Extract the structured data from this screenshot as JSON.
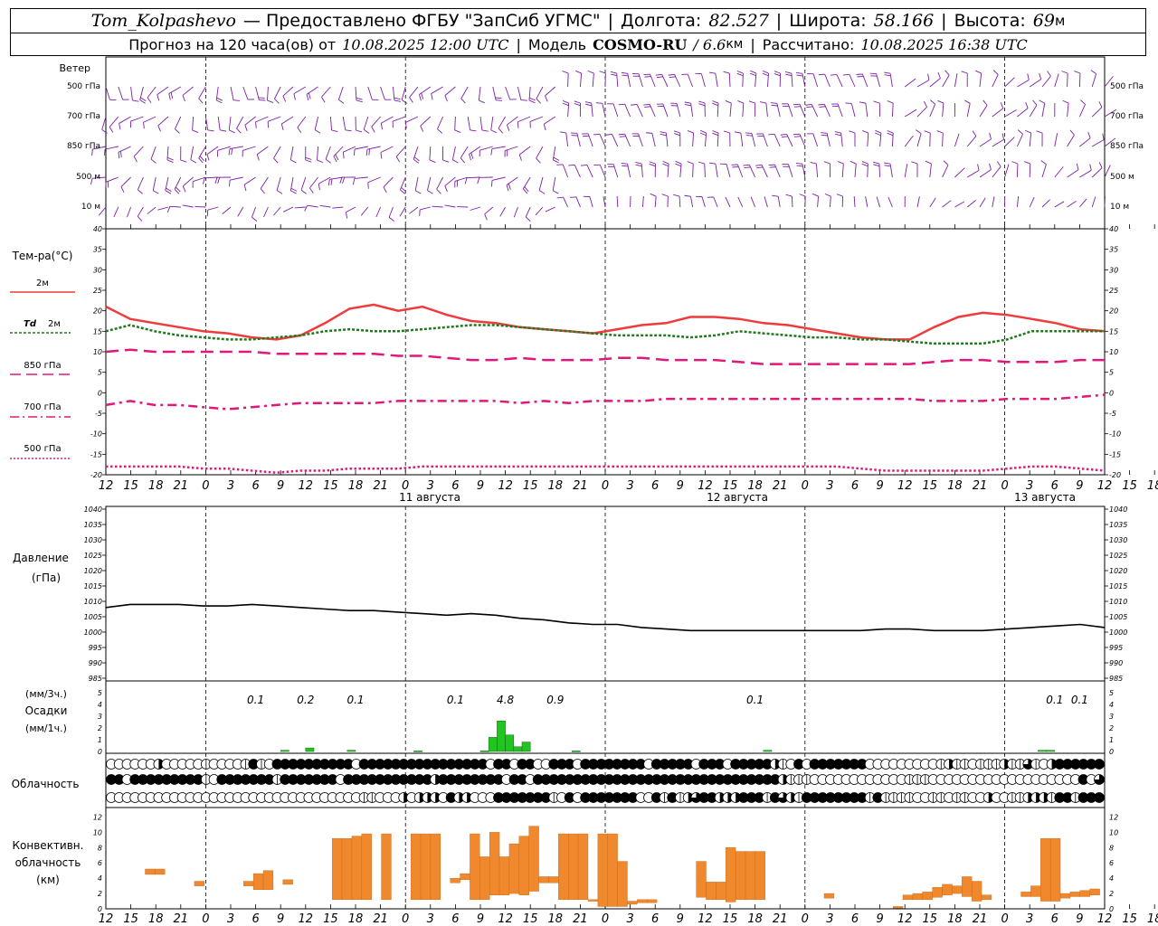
{
  "header": {
    "station": "Tom_Kolpashevo",
    "provider": "— Предоставлено ФГБУ \"ЗапСиб УГМС\"",
    "lon_label": "Долгота:",
    "lon_value": "82.527",
    "lat_label": "Широта:",
    "lat_value": "58.166",
    "alt_label": "Высота:",
    "alt_value": "69",
    "alt_unit": "м",
    "forecast_prefix": "Прогноз на 120 часа(ов) от",
    "forecast_start": "10.08.2025 12:00 UTC",
    "model_label": "Модель",
    "model_name": "COSMO-RU",
    "model_res": "/ 6.6",
    "model_res_unit": "км",
    "calc_label": "Рассчитано:",
    "calc_time": "10.08.2025 16:38 UTC"
  },
  "colors": {
    "wind": "#7b1fa2",
    "t2m": "#ef3b3b",
    "td2m": "#1f7a1f",
    "t850": "#e0187a",
    "t700": "#e0187a",
    "t500": "#e0187a",
    "pressure": "#000000",
    "precip": "#22c422",
    "convective": "#f0892e"
  },
  "labels": {
    "wind": "Ветер",
    "wind_levels": [
      "500 гПа",
      "700 гПа",
      "850 гПа",
      "500 м",
      "10 м"
    ],
    "temp_title": "Тем-ра(°С)",
    "legend_t2m": "2м",
    "legend_td_sym": "Td",
    "legend_td": "2м",
    "legend_850": "850 гПа",
    "legend_700": "700 гПа",
    "legend_500": "500 гПа",
    "pressure_title": "Давление",
    "pressure_unit": "(гПа)",
    "precip_top": "(мм/3ч.)",
    "precip_title": "Осадки",
    "precip_unit": "(мм/1ч.)",
    "cloud_title": "Облачность",
    "conv_title1": "Конвективн.",
    "conv_title2": "облачность",
    "conv_unit": "(км)",
    "dates": [
      "11 августа",
      "12 августа",
      "13 августа"
    ]
  },
  "chart_data": [
    {
      "type": "line",
      "title": "Тем-ра(°С)",
      "x_hours": [
        0,
        3,
        6,
        9,
        12,
        15,
        18,
        21,
        24,
        27,
        30,
        33,
        36,
        39,
        42,
        45,
        48,
        51,
        54,
        57,
        60,
        63,
        66,
        69,
        72,
        75,
        78,
        81,
        84,
        87,
        90,
        93,
        96,
        99,
        102,
        105,
        108,
        111,
        114,
        117,
        120
      ],
      "x_tick_labels": [
        "12",
        "15",
        "18",
        "21",
        "0",
        "3",
        "6",
        "9",
        "12",
        "15",
        "18",
        "21",
        "0",
        "3",
        "6",
        "9",
        "12",
        "15",
        "18",
        "21",
        "0",
        "3",
        "6",
        "9",
        "12",
        "15",
        "18",
        "21",
        "0",
        "3",
        "6",
        "9",
        "12",
        "15",
        "18",
        "21",
        "0",
        "3",
        "6",
        "9",
        "12",
        "15",
        "18"
      ],
      "ylim": [
        -20,
        40
      ],
      "yticks": [
        40,
        35,
        30,
        25,
        20,
        15,
        10,
        5,
        0,
        -5,
        -10,
        -15,
        -20
      ],
      "series": [
        {
          "name": "2м",
          "key": "t2m",
          "values": [
            21,
            18,
            17,
            16,
            15,
            14.5,
            13.5,
            13,
            14,
            17,
            20.5,
            21.5,
            20,
            21,
            19,
            17.5,
            17,
            16,
            15.5,
            15,
            14.5,
            15.5,
            16.5,
            17,
            18.5,
            18.5,
            18,
            17,
            16.5,
            15.5,
            14.5,
            13.5,
            13,
            13,
            16,
            18.5,
            19.5,
            19,
            18,
            17,
            15.5,
            15
          ]
        },
        {
          "name": "Td 2м",
          "key": "td2m",
          "values": [
            15,
            16.5,
            15,
            14,
            13.5,
            13,
            13,
            13.5,
            14,
            15,
            15.5,
            15,
            15,
            15.5,
            16,
            16.5,
            16.5,
            16,
            15.5,
            15,
            14.5,
            14,
            14,
            14,
            13.5,
            14,
            15,
            14.5,
            14,
            13.5,
            13.5,
            13,
            13,
            12.5,
            12,
            12,
            12,
            13,
            15,
            15,
            15,
            15
          ]
        },
        {
          "name": "850 гПа",
          "key": "t850",
          "values": [
            10,
            10.5,
            10,
            10,
            10,
            10,
            10,
            9.5,
            9.5,
            9.5,
            9.5,
            9.5,
            9,
            9,
            8.5,
            8,
            8,
            8.5,
            8,
            8,
            8,
            8.5,
            8.5,
            8,
            8,
            8,
            7.5,
            7,
            7,
            7,
            7,
            7,
            7,
            7,
            7.5,
            8,
            8,
            7.5,
            7.5,
            7.5,
            8,
            8
          ]
        },
        {
          "name": "700 гПа",
          "key": "t700",
          "values": [
            -3,
            -2,
            -3,
            -3,
            -3.5,
            -4,
            -3.5,
            -3,
            -2.5,
            -2.5,
            -2.5,
            -2.5,
            -2,
            -2,
            -2,
            -2,
            -2,
            -2.5,
            -2,
            -2.5,
            -2,
            -2,
            -2,
            -1.5,
            -1.5,
            -1.5,
            -1.5,
            -1.5,
            -1.5,
            -1.5,
            -1.5,
            -1.5,
            -1.5,
            -1.5,
            -2,
            -2,
            -2,
            -1.5,
            -1.5,
            -1.5,
            -1,
            -0.5
          ]
        },
        {
          "name": "500 гПа",
          "key": "t500",
          "values": [
            -18,
            -18,
            -18,
            -18,
            -18.5,
            -18.5,
            -19,
            -19.5,
            -19,
            -19,
            -18.5,
            -18.5,
            -18.5,
            -18,
            -18,
            -18,
            -18,
            -18,
            -18,
            -18,
            -18,
            -18,
            -18,
            -18,
            -18,
            -18,
            -18,
            -18,
            -18,
            -18,
            -18,
            -18.5,
            -19,
            -19,
            -19,
            -19,
            -19,
            -18.5,
            -18,
            -18,
            -18.5,
            -19
          ]
        }
      ]
    },
    {
      "type": "line",
      "title": "Давление",
      "ylabel": "(гПа)",
      "ylim": [
        985,
        1040
      ],
      "yticks": [
        1040,
        1035,
        1030,
        1025,
        1020,
        1015,
        1010,
        1005,
        1000,
        995,
        990,
        985
      ],
      "series": [
        {
          "name": "Давление",
          "values": [
            1008,
            1009,
            1009,
            1009,
            1008.5,
            1008.5,
            1009,
            1008.5,
            1008,
            1007.5,
            1007,
            1007,
            1006.5,
            1006,
            1005.5,
            1006,
            1005.5,
            1004.5,
            1004,
            1003,
            1002.5,
            1002.5,
            1001.5,
            1001,
            1000.5,
            1000.5,
            1000.5,
            1000.5,
            1000.5,
            1000.5,
            1000.5,
            1000.5,
            1001,
            1001,
            1000.5,
            1000.5,
            1000.5,
            1001,
            1001.5,
            1002,
            1002.5,
            1001.5
          ]
        }
      ]
    },
    {
      "type": "bar",
      "title": "Осадки",
      "ylabel": "(мм/1ч.)",
      "ylim": [
        0,
        5
      ],
      "yticks": [
        5,
        4,
        3,
        2,
        1,
        0
      ],
      "bars_mm_1h": [
        [
          21,
          0.1
        ],
        [
          24,
          0.3
        ],
        [
          29,
          0.1
        ],
        [
          37,
          0.05
        ],
        [
          45,
          0.05
        ],
        [
          46,
          1.2
        ],
        [
          47,
          2.6
        ],
        [
          48,
          1.4
        ],
        [
          49,
          0.4
        ],
        [
          50,
          0.8
        ],
        [
          56,
          0.05
        ],
        [
          79,
          0.1
        ],
        [
          112,
          0.1
        ],
        [
          113,
          0.1
        ]
      ],
      "labels_mm_3h": [
        {
          "hour": 18,
          "text": "0.1"
        },
        {
          "hour": 24,
          "text": "0.2"
        },
        {
          "hour": 30,
          "text": "0.1"
        },
        {
          "hour": 42,
          "text": "0.1"
        },
        {
          "hour": 48,
          "text": "4.8"
        },
        {
          "hour": 54,
          "text": "0.9"
        },
        {
          "hour": 78,
          "text": "0.1"
        },
        {
          "hour": 114,
          "text": "0.1"
        },
        {
          "hour": 117,
          "text": "0.1"
        }
      ]
    },
    {
      "type": "table",
      "title": "Облачность",
      "rows": [
        "000000200000100001410444444444404444444444444444044044004440444444440444440444044444210404444444000000000121101112113102444444",
        "440444444444104444444144444440444444444442444444440440444444444444444444444444444444421110000000000001110000000000000000000403",
        "000000000000000000000000000000001100020222042200044444441040444444400414123442224441432144444444141111001101100200112221441444"
      ]
    },
    {
      "type": "bar",
      "title": "Конвективн. облачность",
      "ylabel": "(км)",
      "ylim": [
        0,
        13
      ],
      "yticks": [
        12,
        10,
        8,
        6,
        4,
        2,
        0
      ],
      "bars_km": [
        [
          4,
          4.5,
          5.2
        ],
        [
          5,
          4.5,
          5.2
        ],
        [
          9,
          3,
          3.6
        ],
        [
          14,
          3,
          3.6
        ],
        [
          15,
          2.5,
          4.6
        ],
        [
          16,
          2.5,
          5
        ],
        [
          18,
          3.2,
          3.8
        ],
        [
          23,
          1.2,
          9.2
        ],
        [
          24,
          1.2,
          9.2
        ],
        [
          25,
          1.2,
          9.5
        ],
        [
          26,
          1.2,
          9.8
        ],
        [
          28,
          1.2,
          9.8
        ],
        [
          31,
          1.2,
          9.8
        ],
        [
          32,
          1.2,
          9.8
        ],
        [
          33,
          1.2,
          9.8
        ],
        [
          35,
          3.4,
          4
        ],
        [
          36,
          3.8,
          4.6
        ],
        [
          37,
          1.2,
          9.8
        ],
        [
          38,
          1.2,
          6.8
        ],
        [
          39,
          1.8,
          10
        ],
        [
          40,
          1.8,
          6.8
        ],
        [
          41,
          2,
          8.5
        ],
        [
          42,
          1.8,
          9.5
        ],
        [
          43,
          2.3,
          10.8
        ],
        [
          44,
          3.4,
          4.2
        ],
        [
          45,
          3.4,
          4.2
        ],
        [
          46,
          1.2,
          9.8
        ],
        [
          47,
          1.2,
          9.8
        ],
        [
          48,
          1.2,
          9.8
        ],
        [
          49,
          1,
          1.2
        ],
        [
          50,
          0.3,
          9.8
        ],
        [
          51,
          0.3,
          9.8
        ],
        [
          52,
          0.3,
          6.2
        ],
        [
          53,
          0.6,
          1
        ],
        [
          54,
          0.8,
          1.2
        ],
        [
          55,
          0.8,
          1.2
        ],
        [
          60,
          1.5,
          6.2
        ],
        [
          61,
          1.2,
          3.5
        ],
        [
          62,
          1.2,
          3.5
        ],
        [
          63,
          0.9,
          8
        ],
        [
          64,
          1.2,
          7.5
        ],
        [
          65,
          1.2,
          7.5
        ],
        [
          66,
          1.2,
          7.5
        ],
        [
          73,
          1.4,
          2
        ],
        [
          80,
          0.1,
          0.3
        ],
        [
          81,
          1.2,
          1.8
        ],
        [
          82,
          1.2,
          2
        ],
        [
          83,
          1.2,
          2.2
        ],
        [
          84,
          1.5,
          2.8
        ],
        [
          85,
          1.8,
          3.2
        ],
        [
          86,
          2,
          3
        ],
        [
          87,
          1.6,
          4.2
        ],
        [
          88,
          1,
          3.6
        ],
        [
          89,
          1.2,
          1.8
        ],
        [
          93,
          1.6,
          2.2
        ],
        [
          94,
          1.6,
          3
        ],
        [
          95,
          1,
          9.2
        ],
        [
          96,
          1,
          9.2
        ],
        [
          97,
          1.4,
          2
        ],
        [
          98,
          1.6,
          2.2
        ],
        [
          99,
          1.6,
          2.4
        ],
        [
          100,
          1.8,
          2.6
        ]
      ]
    }
  ]
}
